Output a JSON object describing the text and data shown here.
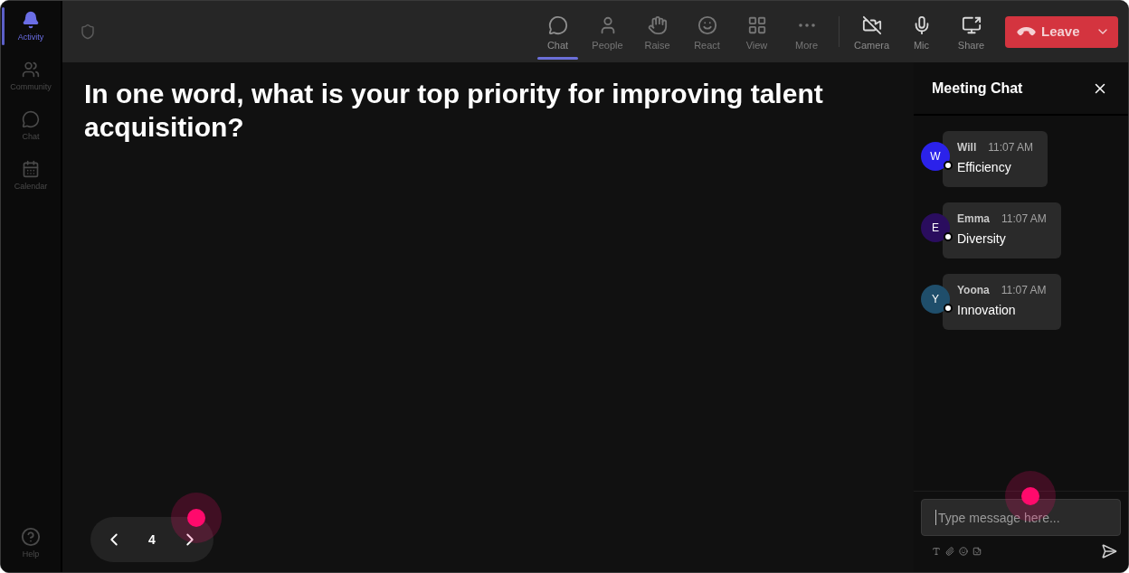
{
  "sidebar": {
    "items": [
      {
        "label": "Activity",
        "selected": true
      },
      {
        "label": "Community",
        "selected": false
      },
      {
        "label": "Chat",
        "selected": false
      },
      {
        "label": "Calendar",
        "selected": false
      }
    ],
    "help": {
      "label": "Help"
    }
  },
  "toolbar": {
    "items": [
      {
        "label": "Chat",
        "selected": true
      },
      {
        "label": "People",
        "selected": false
      },
      {
        "label": "Raise",
        "selected": false
      },
      {
        "label": "React",
        "selected": false
      },
      {
        "label": "View",
        "selected": false
      },
      {
        "label": "More",
        "selected": false
      }
    ],
    "devices": [
      {
        "label": "Camera"
      },
      {
        "label": "Mic"
      },
      {
        "label": "Share"
      }
    ],
    "leave": {
      "label": "Leave"
    }
  },
  "question": {
    "text": "In one word, what is your top priority for improving talent acquisition?"
  },
  "pager": {
    "page": "4"
  },
  "chat": {
    "title": "Meeting Chat",
    "messages": [
      {
        "initial": "W",
        "name": "Will",
        "time": "11:07 AM",
        "text": "Efficiency",
        "color": "#2b22ea"
      },
      {
        "initial": "E",
        "name": "Emma",
        "time": "11:07 AM",
        "text": "Diversity",
        "color": "#2a0d5e"
      },
      {
        "initial": "Y",
        "name": "Yoona",
        "time": "11:07 AM",
        "text": "Innovation",
        "color": "#1f4e6b"
      }
    ],
    "input": {
      "placeholder": "Type message here..."
    }
  }
}
